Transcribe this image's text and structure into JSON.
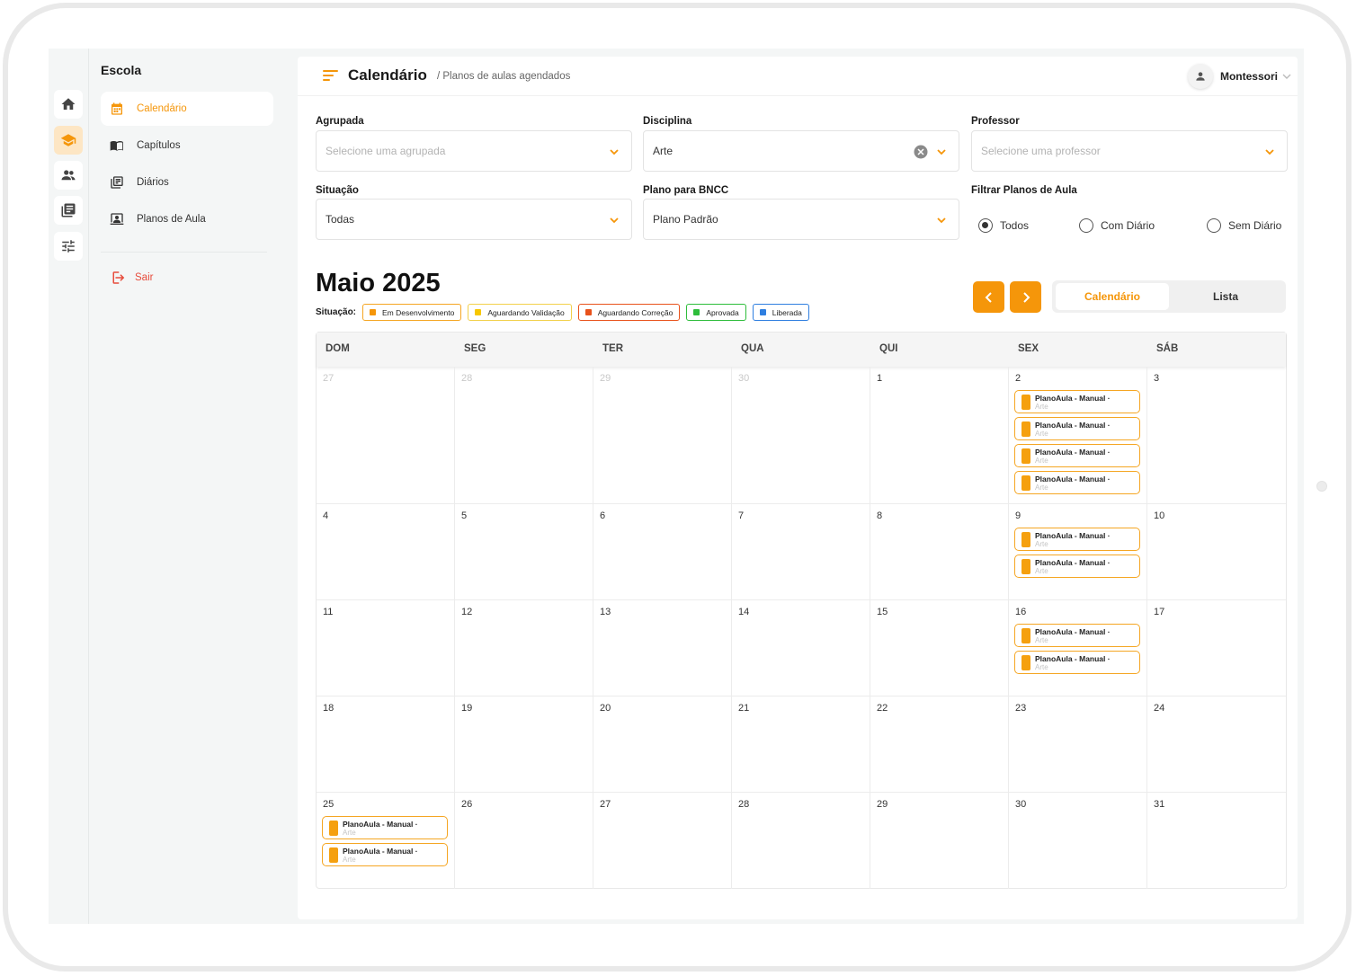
{
  "nav": {
    "title": "Escola",
    "items": [
      {
        "label": "Calendário",
        "icon": "calendar-icon",
        "active": true
      },
      {
        "label": "Capítulos",
        "icon": "book-open-icon",
        "active": false
      },
      {
        "label": "Diários",
        "icon": "journal-icon",
        "active": false
      },
      {
        "label": "Planos de Aula",
        "icon": "lesson-plan-icon",
        "active": false
      }
    ],
    "exit_label": "Sair"
  },
  "rail": [
    "home-icon",
    "school-icon",
    "people-icon",
    "library-icon",
    "settings-sliders-icon"
  ],
  "header": {
    "title": "Calendário",
    "subtitle": "/ Planos de aulas agendados",
    "user": "Montessori"
  },
  "filters": {
    "agrupada": {
      "label": "Agrupada",
      "placeholder": "Selecione uma agrupada"
    },
    "disciplina": {
      "label": "Disciplina",
      "value": "Arte"
    },
    "professor": {
      "label": "Professor",
      "placeholder": "Selecione uma professor"
    },
    "situacao": {
      "label": "Situação",
      "value": "Todas"
    },
    "bncc": {
      "label": "Plano para BNCC",
      "value": "Plano Padrão"
    },
    "filtrar": {
      "label": "Filtrar Planos de Aula",
      "options": [
        "Todos",
        "Com Diário",
        "Sem Diário"
      ],
      "selected": "Todos"
    }
  },
  "calendar": {
    "month_title": "Maio 2025",
    "legend_label": "Situação:",
    "legend": [
      {
        "label": "Em Desenvolvimento",
        "color": "#f5960a",
        "border": "#f5a623"
      },
      {
        "label": "Aguardando Validação",
        "color": "#f7c700",
        "border": "#f2d04b"
      },
      {
        "label": "Aguardando Correção",
        "color": "#e8521b",
        "border": "#e8521b"
      },
      {
        "label": "Aprovada",
        "color": "#2ebd3b",
        "border": "#2ebd3b"
      },
      {
        "label": "Liberada",
        "color": "#2f7fe0",
        "border": "#2f7fe0"
      }
    ],
    "view_options": [
      "Calendário",
      "Lista"
    ],
    "view_selected": "Calendário",
    "weekdays": [
      "DOM",
      "SEG",
      "TER",
      "QUA",
      "QUI",
      "SEX",
      "SÁB"
    ],
    "weeks": [
      [
        {
          "d": "27",
          "muted": true
        },
        {
          "d": "28",
          "muted": true
        },
        {
          "d": "29",
          "muted": true
        },
        {
          "d": "30",
          "muted": true
        },
        {
          "d": "1"
        },
        {
          "d": "2",
          "events": 4
        },
        {
          "d": "3"
        }
      ],
      [
        {
          "d": "4"
        },
        {
          "d": "5"
        },
        {
          "d": "6"
        },
        {
          "d": "7"
        },
        {
          "d": "8"
        },
        {
          "d": "9",
          "events": 2
        },
        {
          "d": "10"
        }
      ],
      [
        {
          "d": "11"
        },
        {
          "d": "12"
        },
        {
          "d": "13"
        },
        {
          "d": "14"
        },
        {
          "d": "15"
        },
        {
          "d": "16",
          "events": 2
        },
        {
          "d": "17"
        }
      ],
      [
        {
          "d": "18"
        },
        {
          "d": "19"
        },
        {
          "d": "20"
        },
        {
          "d": "21"
        },
        {
          "d": "22"
        },
        {
          "d": "23"
        },
        {
          "d": "24"
        }
      ],
      [
        {
          "d": "25",
          "events": 2
        },
        {
          "d": "26"
        },
        {
          "d": "27"
        },
        {
          "d": "28"
        },
        {
          "d": "29"
        },
        {
          "d": "30"
        },
        {
          "d": "31"
        }
      ]
    ],
    "event": {
      "title": "PlanoAula - Manual ·",
      "subtitle": "Arte"
    }
  }
}
